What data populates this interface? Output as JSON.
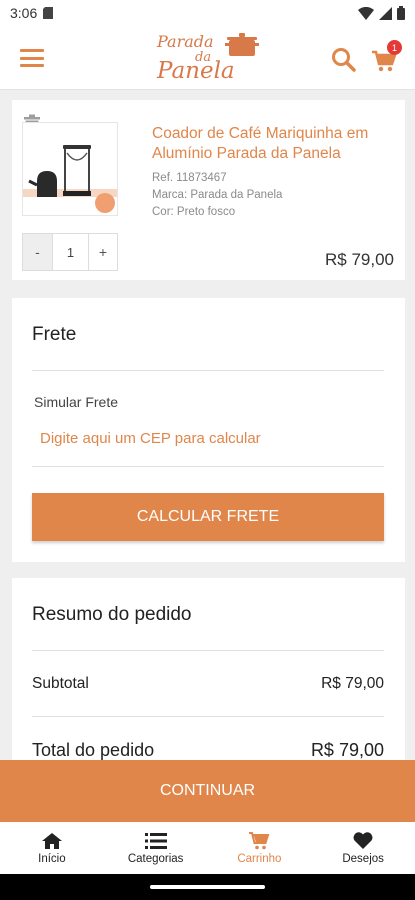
{
  "status": {
    "time": "3:06"
  },
  "header": {
    "logo_line1": "Parada",
    "logo_line2": "da",
    "logo_line3": "Panela",
    "cart_count": "1"
  },
  "product": {
    "title": "Coador de Café Mariquinha em Alumínio Parada da Panela",
    "ref": "Ref. 11873467",
    "brand": "Marca: Parada da Panela",
    "color": "Cor: Preto fosco",
    "qty": "1",
    "minus": "-",
    "plus": "+",
    "price": "R$ 79,00"
  },
  "frete": {
    "heading": "Frete",
    "sim_label": "Simular Frete",
    "placeholder": "Digite aqui um CEP para calcular",
    "button": "CALCULAR FRETE"
  },
  "resumo": {
    "heading": "Resumo do pedido",
    "subtotal_label": "Subtotal",
    "subtotal_value": "R$ 79,00",
    "total_label": "Total do pedido",
    "total_value": "R$ 79,00"
  },
  "continue_button": "CONTINUAR",
  "nav": {
    "inicio": "Início",
    "categorias": "Categorias",
    "carrinho": "Carrinho",
    "desejos": "Desejos"
  },
  "colors": {
    "accent": "#e0864a",
    "badge": "#e53935"
  }
}
